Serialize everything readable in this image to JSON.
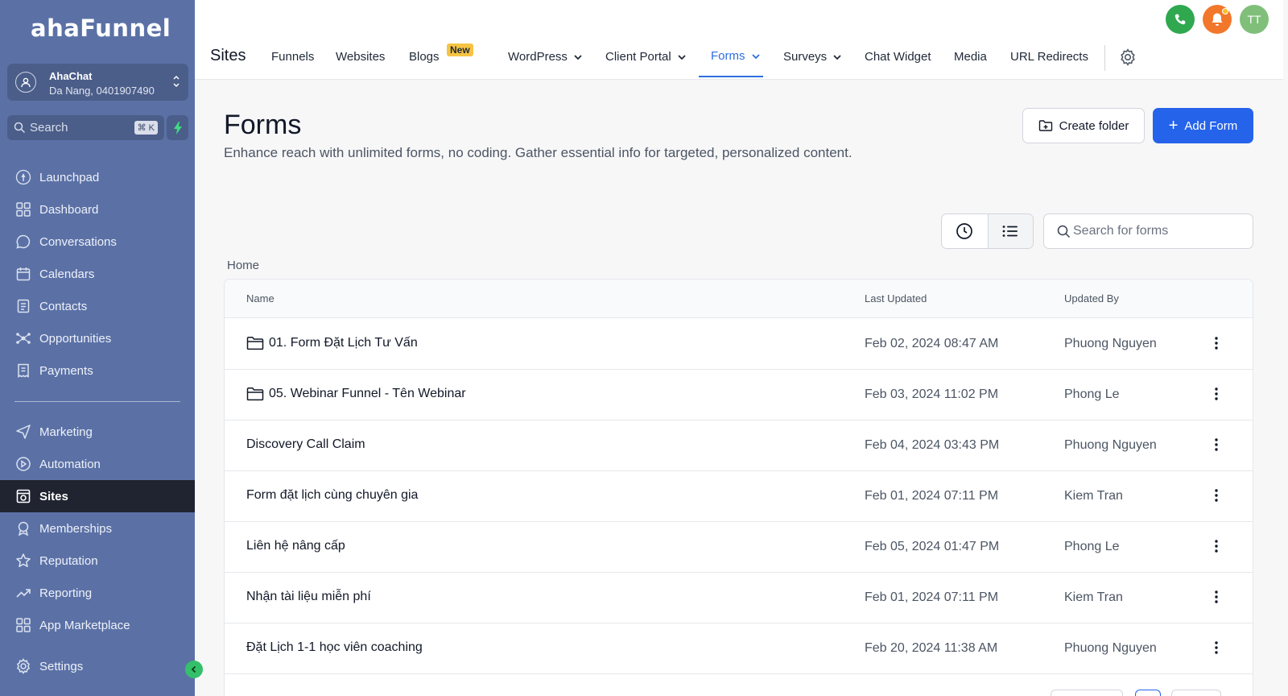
{
  "brand": {
    "logo": "ahaFunnel"
  },
  "account": {
    "name": "AhaChat",
    "location": "Da Nang, 0401907490"
  },
  "sidebar_search": {
    "placeholder": "Search",
    "shortcut": "⌘ K"
  },
  "sidebar": {
    "items": [
      {
        "label": "Launchpad",
        "icon": "rocket-icon"
      },
      {
        "label": "Dashboard",
        "icon": "grid-icon"
      },
      {
        "label": "Conversations",
        "icon": "chat-icon"
      },
      {
        "label": "Calendars",
        "icon": "calendar-icon"
      },
      {
        "label": "Contacts",
        "icon": "contacts-icon"
      },
      {
        "label": "Opportunities",
        "icon": "network-icon"
      },
      {
        "label": "Payments",
        "icon": "receipt-icon"
      },
      {
        "label": "Marketing",
        "icon": "send-icon"
      },
      {
        "label": "Automation",
        "icon": "play-circle-icon"
      },
      {
        "label": "Sites",
        "icon": "globe-window-icon",
        "active": true
      },
      {
        "label": "Memberships",
        "icon": "award-icon"
      },
      {
        "label": "Reputation",
        "icon": "star-icon"
      },
      {
        "label": "Reporting",
        "icon": "trend-icon"
      },
      {
        "label": "App Marketplace",
        "icon": "apps-icon"
      },
      {
        "label": "Settings",
        "icon": "gear-icon"
      }
    ]
  },
  "topbar": {
    "section": "Sites",
    "tabs": [
      {
        "label": "Funnels"
      },
      {
        "label": "Websites"
      },
      {
        "label": "Blogs",
        "badge": "New"
      },
      {
        "label": "WordPress",
        "dropdown": true
      },
      {
        "label": "Client Portal",
        "dropdown": true
      },
      {
        "label": "Forms",
        "dropdown": true,
        "active": true
      },
      {
        "label": "Surveys",
        "dropdown": true
      },
      {
        "label": "Chat Widget"
      },
      {
        "label": "Media"
      },
      {
        "label": "URL Redirects"
      }
    ],
    "user_initials": "TT"
  },
  "page": {
    "title": "Forms",
    "description": "Enhance reach with unlimited forms, no coding. Gather essential info for targeted, personalized content.",
    "create_folder": "Create folder",
    "add_form": "Add Form",
    "search_placeholder": "Search for forms",
    "breadcrumb": "Home"
  },
  "table": {
    "headers": {
      "name": "Name",
      "updated": "Last Updated",
      "by": "Updated By"
    },
    "rows": [
      {
        "name": "01. Form Đặt Lịch Tư Vấn",
        "folder": true,
        "updated": "Feb 02, 2024 08:47 AM",
        "by": "Phuong Nguyen"
      },
      {
        "name": "05. Webinar Funnel - Tên Webinar",
        "folder": true,
        "updated": "Feb 03, 2024 11:02 PM",
        "by": "Phong Le"
      },
      {
        "name": "Discovery Call Claim",
        "folder": false,
        "updated": "Feb 04, 2024 03:43 PM",
        "by": "Phuong Nguyen"
      },
      {
        "name": "Form đặt lịch cùng chuyên gia",
        "folder": false,
        "updated": "Feb 01, 2024 07:11 PM",
        "by": "Kiem Tran"
      },
      {
        "name": "Liên hệ nâng cấp",
        "folder": false,
        "updated": "Feb 05, 2024 01:47 PM",
        "by": "Phong Le"
      },
      {
        "name": "Nhận tài liệu miễn phí",
        "folder": false,
        "updated": "Feb 01, 2024 07:11 PM",
        "by": "Kiem Tran"
      },
      {
        "name": "Đặt Lịch 1-1 học viên coaching",
        "folder": false,
        "updated": "Feb 20, 2024 11:38 AM",
        "by": "Phuong Nguyen"
      }
    ]
  },
  "colors": {
    "sidebar": "#5b71a6",
    "active_nav": "#1f2430",
    "accent": "#2563eb",
    "phone": "#2fa84f",
    "bell": "#f2772b",
    "avatar": "#7fbf7a"
  }
}
